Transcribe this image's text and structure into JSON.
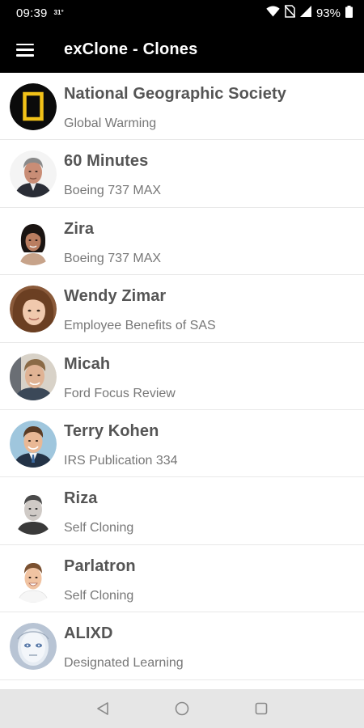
{
  "status_bar": {
    "time": "09:39",
    "temp": "31°",
    "battery": "93%",
    "icons": [
      "wifi-icon",
      "no-sim-icon",
      "signal-icon",
      "battery-icon"
    ]
  },
  "app_bar": {
    "title": "exClone - Clones",
    "menu_icon": "hamburger-menu-icon"
  },
  "clones": [
    {
      "name": "National Geographic Society",
      "subtitle": "Global Warming",
      "avatar": "natgeo-logo"
    },
    {
      "name": "60 Minutes",
      "subtitle": "Boeing 737 MAX",
      "avatar": "portrait-older-man"
    },
    {
      "name": "Zira",
      "subtitle": "Boeing 737 MAX",
      "avatar": "portrait-woman-dark-hair"
    },
    {
      "name": "Wendy Zimar",
      "subtitle": "Employee Benefits of SAS",
      "avatar": "portrait-woman-brown-hair"
    },
    {
      "name": "Micah",
      "subtitle": "Ford Focus Review",
      "avatar": "portrait-young-man"
    },
    {
      "name": "Terry Kohen",
      "subtitle": "IRS Publication 334",
      "avatar": "portrait-man-suit"
    },
    {
      "name": "Riza",
      "subtitle": "Self Cloning",
      "avatar": "portrait-man-gray"
    },
    {
      "name": "Parlatron",
      "subtitle": "Self Cloning",
      "avatar": "portrait-young-man-smiling"
    },
    {
      "name": "ALIXD",
      "subtitle": "Designated Learning",
      "avatar": "robot-face"
    }
  ],
  "nav_bar": {
    "icons": [
      "back-icon",
      "home-icon",
      "recents-icon"
    ]
  },
  "colors": {
    "app_bar": "#000000",
    "natgeo_yellow": "#f2c218",
    "title_text": "#555555",
    "subtitle_text": "#777777",
    "nav_bar": "#e6e6e6"
  }
}
